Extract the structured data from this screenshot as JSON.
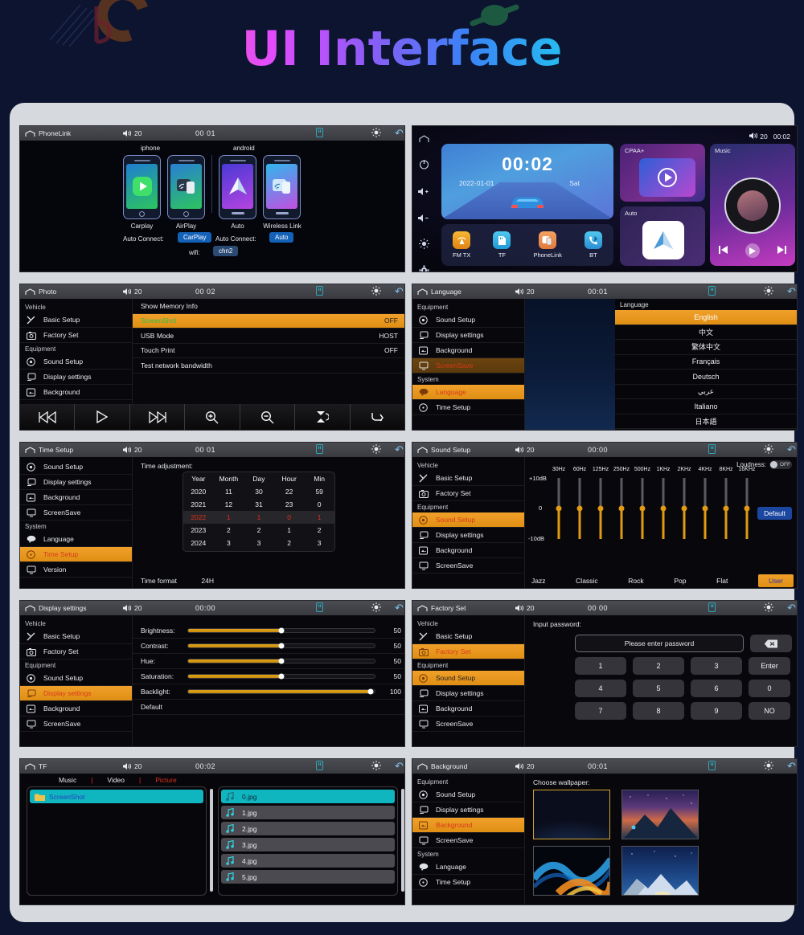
{
  "page": {
    "title": "UI Interface"
  },
  "colors": {
    "accent_orange": "#e08f14",
    "selected_text_red": "#d83a1a",
    "teal": "#0fb6bf",
    "blue_button": "#1b47a0",
    "background": "#0c1430",
    "card": "#d6d9de"
  },
  "screens": [
    {
      "id": "phonelink",
      "statusbar": {
        "title": "PhoneLink",
        "volume": "20",
        "clock": "00  01"
      },
      "groups": [
        {
          "label": "iphone"
        },
        {
          "label": "android"
        }
      ],
      "devices": [
        {
          "caption": "Carplay"
        },
        {
          "caption": "AirPlay"
        },
        {
          "caption": "Auto"
        },
        {
          "caption": "Wireless Link"
        }
      ],
      "auto_connect_label_left": "Auto Connect:",
      "auto_connect_value_left": "CarPlay",
      "auto_connect_label_right": "Auto Connect:",
      "auto_connect_value_right": "Auto",
      "wifi_label": "wifi:",
      "wifi_value": "chn2"
    },
    {
      "id": "home",
      "statusbar": {
        "volume": "20",
        "clock": "00:02"
      },
      "clock_card": {
        "time": "00:02",
        "date": "2022-01-01",
        "day": "Sat"
      },
      "apps": [
        {
          "label": "FM TX"
        },
        {
          "label": "TF"
        },
        {
          "label": "PhoneLink"
        },
        {
          "label": "BT"
        }
      ],
      "tiles": [
        {
          "label": "CPAA+"
        },
        {
          "label": "Auto"
        },
        {
          "label": "Music"
        }
      ]
    },
    {
      "id": "photo",
      "statusbar": {
        "title": "Photo",
        "volume": "20",
        "clock": "00  02"
      },
      "menu": [
        {
          "group": "Vehicle"
        },
        {
          "label": "Basic Setup",
          "icon": "wrench-icon"
        },
        {
          "label": "Factory Set",
          "icon": "factory-icon"
        },
        {
          "group": "Equipment"
        },
        {
          "label": "Sound Setup",
          "icon": "speaker-icon"
        },
        {
          "label": "Display settings",
          "icon": "display-icon"
        },
        {
          "label": "Background",
          "icon": "image-icon"
        }
      ],
      "rows": [
        {
          "label": "Show Memory Info",
          "value": ""
        },
        {
          "label": "ScreenShot",
          "value": "OFF",
          "highlighted": true
        },
        {
          "label": "USB Mode",
          "value": "HOST"
        },
        {
          "label": "Touch Print",
          "value": "OFF"
        },
        {
          "label": "Test network bandwidth",
          "value": ""
        }
      ],
      "mediabar": [
        "prev-icon",
        "play-icon",
        "next-icon",
        "zoom-in-icon",
        "zoom-out-icon",
        "rotate-icon",
        "return-icon"
      ]
    },
    {
      "id": "language",
      "statusbar": {
        "title": "Language",
        "volume": "20",
        "clock": "00:01"
      },
      "menu": [
        {
          "group": "Equipment"
        },
        {
          "label": "Sound Setup",
          "icon": "speaker-icon"
        },
        {
          "label": "Display settings",
          "icon": "display-icon"
        },
        {
          "label": "Background",
          "icon": "image-icon"
        },
        {
          "label": "ScreenSave",
          "icon": "monitor-icon",
          "dim_selected": true
        },
        {
          "group": "System"
        },
        {
          "label": "Language",
          "icon": "language-icon",
          "selected": true
        },
        {
          "label": "Time Setup",
          "icon": "clock-icon"
        }
      ],
      "list_header": "Language",
      "languages": [
        {
          "label": "English",
          "selected": true
        },
        {
          "label": "中文"
        },
        {
          "label": "繁体中文"
        },
        {
          "label": "Français"
        },
        {
          "label": "Deutsch"
        },
        {
          "label": "عربي"
        },
        {
          "label": "Italiano"
        },
        {
          "label": "日本語"
        }
      ]
    },
    {
      "id": "timesetup",
      "statusbar": {
        "title": "Time Setup",
        "volume": "20",
        "clock": "00  01"
      },
      "menu": [
        {
          "label": "Sound Setup",
          "icon": "speaker-icon"
        },
        {
          "label": "Display settings",
          "icon": "display-icon"
        },
        {
          "label": "Background",
          "icon": "image-icon"
        },
        {
          "label": "ScreenSave",
          "icon": "monitor-icon"
        },
        {
          "group": "System"
        },
        {
          "label": "Language",
          "icon": "language-icon"
        },
        {
          "label": "Time Setup",
          "icon": "clock-icon",
          "selected": true
        },
        {
          "label": "Version",
          "icon": "monitor-icon"
        }
      ],
      "section_title": "Time adjustment:",
      "columns": [
        "Year",
        "Month",
        "Day",
        "Hour",
        "Min"
      ],
      "rows": [
        [
          "2020",
          "11",
          "30",
          "22",
          "59"
        ],
        [
          "2021",
          "12",
          "31",
          "23",
          "0"
        ],
        [
          "2022",
          "1",
          "1",
          "0",
          "1"
        ],
        [
          "2023",
          "2",
          "2",
          "1",
          "2"
        ],
        [
          "2024",
          "3",
          "3",
          "2",
          "3"
        ]
      ],
      "current_row_index": 2,
      "time_format_label": "Time format",
      "time_format_value": "24H"
    },
    {
      "id": "soundsetup",
      "statusbar": {
        "title": "Sound Setup",
        "volume": "20",
        "clock": "00:00"
      },
      "menu": [
        {
          "group": "Vehicle"
        },
        {
          "label": "Basic Setup",
          "icon": "wrench-icon"
        },
        {
          "label": "Factory Set",
          "icon": "factory-icon"
        },
        {
          "group": "Equipment"
        },
        {
          "label": "Sound Setup",
          "icon": "speaker-icon",
          "selected": true
        },
        {
          "label": "Display settings",
          "icon": "display-icon"
        },
        {
          "label": "Background",
          "icon": "image-icon"
        },
        {
          "label": "ScreenSave",
          "icon": "monitor-icon"
        }
      ],
      "loudness_label": "Loudness:",
      "loudness_value": "OFF",
      "default_button": "Default",
      "axis": {
        "top": "+10dB",
        "mid": "0",
        "bottom": "-10dB"
      },
      "bands": [
        "30Hz",
        "60Hz",
        "125Hz",
        "250Hz",
        "500Hz",
        "1KHz",
        "2KHz",
        "4KHz",
        "8KHz",
        "16KHz"
      ],
      "band_values": [
        0,
        0,
        0,
        0,
        0,
        0,
        0,
        0,
        0,
        0
      ],
      "presets": [
        {
          "label": "Jazz"
        },
        {
          "label": "Classic"
        },
        {
          "label": "Rock"
        },
        {
          "label": "Pop"
        },
        {
          "label": "Flat"
        },
        {
          "label": "User",
          "selected": true
        }
      ]
    },
    {
      "id": "displaysettings",
      "statusbar": {
        "title": "Display settings",
        "volume": "20",
        "clock": "00:00"
      },
      "menu": [
        {
          "group": "Vehicle"
        },
        {
          "label": "Basic Setup",
          "icon": "wrench-icon"
        },
        {
          "label": "Factory Set",
          "icon": "factory-icon"
        },
        {
          "group": "Equipment"
        },
        {
          "label": "Sound Setup",
          "icon": "speaker-icon"
        },
        {
          "label": "Display settings",
          "icon": "display-icon",
          "selected": true
        },
        {
          "label": "Background",
          "icon": "image-icon"
        },
        {
          "label": "ScreenSave",
          "icon": "monitor-icon"
        }
      ],
      "sliders": [
        {
          "label": "Brightness:",
          "value": 50
        },
        {
          "label": "Contrast:",
          "value": 50
        },
        {
          "label": "Hue:",
          "value": 50
        },
        {
          "label": "Saturation:",
          "value": 50
        },
        {
          "label": "Backlight:",
          "value": 100
        }
      ],
      "default_row": "Default"
    },
    {
      "id": "factoryset",
      "statusbar": {
        "title": "Factory Set",
        "volume": "20",
        "clock": "00  00"
      },
      "menu": [
        {
          "group": "Vehicle"
        },
        {
          "label": "Basic Setup",
          "icon": "wrench-icon"
        },
        {
          "label": "Factory Set",
          "icon": "factory-icon",
          "selected": true
        },
        {
          "group": "Equipment"
        },
        {
          "label": "Sound Setup",
          "icon": "speaker-icon",
          "selected_orange": true
        },
        {
          "label": "Display settings",
          "icon": "display-icon"
        },
        {
          "label": "Background",
          "icon": "image-icon"
        },
        {
          "label": "ScreenSave",
          "icon": "monitor-icon"
        }
      ],
      "prompt": "Input password:",
      "input_placeholder": "Please enter password",
      "backspace": "backspace-icon",
      "keys": [
        [
          "1",
          "2",
          "3",
          "Enter"
        ],
        [
          "4",
          "5",
          "6",
          "0"
        ],
        [
          "7",
          "8",
          "9",
          "NO"
        ]
      ]
    },
    {
      "id": "tf",
      "statusbar": {
        "title": "TF",
        "volume": "20",
        "clock": "00:02"
      },
      "tabs": [
        {
          "label": "Music"
        },
        {
          "label": "Video"
        },
        {
          "label": "Picture",
          "selected": true
        }
      ],
      "folders": [
        {
          "label": "ScreenShot",
          "selected": true
        }
      ],
      "files": [
        {
          "label": "0.jpg",
          "selected": true
        },
        {
          "label": "1.jpg"
        },
        {
          "label": "2.jpg"
        },
        {
          "label": "3.jpg"
        },
        {
          "label": "4.jpg"
        },
        {
          "label": "5.jpg"
        }
      ]
    },
    {
      "id": "background",
      "statusbar": {
        "title": "Background",
        "volume": "20",
        "clock": "00:01"
      },
      "menu": [
        {
          "group": "Equipment"
        },
        {
          "label": "Sound Setup",
          "icon": "speaker-icon"
        },
        {
          "label": "Display settings",
          "icon": "display-icon"
        },
        {
          "label": "Background",
          "icon": "image-icon",
          "selected": true
        },
        {
          "label": "ScreenSave",
          "icon": "monitor-icon"
        },
        {
          "group": "System"
        },
        {
          "label": "Language",
          "icon": "language-icon"
        },
        {
          "label": "Time Setup",
          "icon": "clock-icon"
        }
      ],
      "prompt": "Choose wallpaper:",
      "wallpapers": [
        {
          "name": "dark-gradient",
          "selected": true
        },
        {
          "name": "starry-mountain"
        },
        {
          "name": "fire-ice-smoke"
        },
        {
          "name": "snow-peaks"
        }
      ]
    }
  ]
}
